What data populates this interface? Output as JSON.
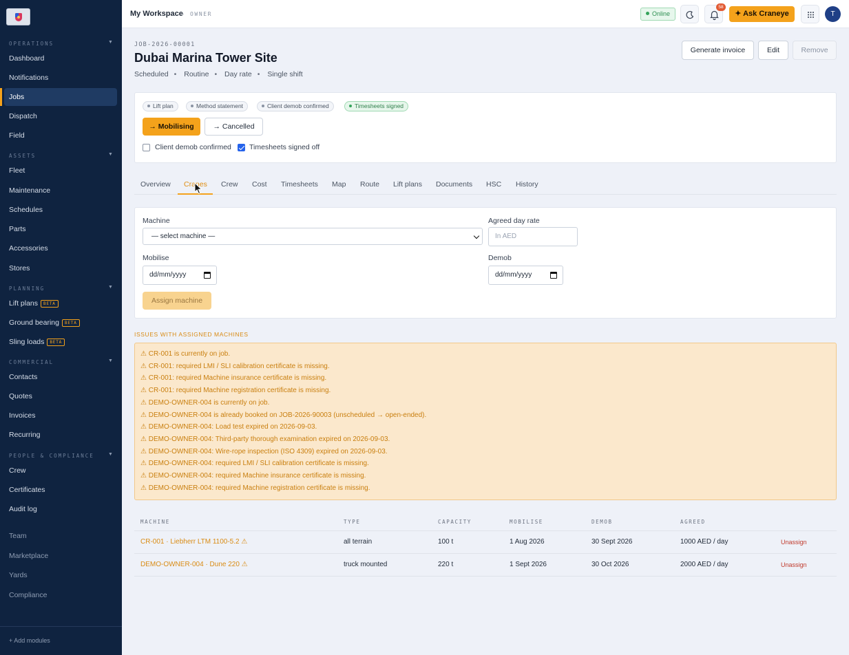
{
  "sidebar": {
    "sections": [
      {
        "title": "OPERATIONS",
        "items": [
          {
            "label": "Dashboard"
          },
          {
            "label": "Notifications"
          },
          {
            "label": "Jobs"
          },
          {
            "label": "Dispatch"
          },
          {
            "label": "Field"
          }
        ]
      },
      {
        "title": "ASSETS",
        "items": [
          {
            "label": "Fleet"
          },
          {
            "label": "Maintenance"
          },
          {
            "label": "Schedules"
          },
          {
            "label": "Parts"
          },
          {
            "label": "Accessories"
          },
          {
            "label": "Stores"
          }
        ]
      },
      {
        "title": "PLANNING",
        "items": [
          {
            "label": "Lift plans",
            "badge": "BETA"
          },
          {
            "label": "Ground bearing",
            "badge": "BETA"
          },
          {
            "label": "Sling loads",
            "badge": "BETA"
          }
        ]
      },
      {
        "title": "COMMERCIAL",
        "items": [
          {
            "label": "Contacts"
          },
          {
            "label": "Quotes"
          },
          {
            "label": "Invoices"
          },
          {
            "label": "Recurring"
          }
        ]
      },
      {
        "title": "PEOPLE & COMPLIANCE",
        "items": [
          {
            "label": "Crew"
          },
          {
            "label": "Certificates"
          },
          {
            "label": "Audit log"
          }
        ]
      }
    ],
    "extra_items": [
      "Team",
      "Marketplace",
      "Yards",
      "Compliance"
    ],
    "add_modules": "Add modules",
    "active_item": "Jobs"
  },
  "topbar": {
    "workspace": "My Workspace",
    "separator": "·",
    "role": "OWNER",
    "status": "Online",
    "notification_count": "58",
    "ask_label": "Ask Craneye",
    "avatar_initial": "T"
  },
  "job": {
    "code": "JOB-2026-00001",
    "title": "Dubai Marina Tower Site",
    "meta": [
      "Scheduled",
      "Routine",
      "Day rate",
      "Single shift"
    ],
    "actions": {
      "generate_invoice": "Generate invoice",
      "edit": "Edit",
      "remove": "Remove"
    }
  },
  "status_card": {
    "chips": [
      {
        "label": "Lift plan",
        "ok": false
      },
      {
        "label": "Method statement",
        "ok": false
      },
      {
        "label": "Client demob confirmed",
        "ok": false
      },
      {
        "label": "Timesheets signed",
        "ok": true
      }
    ],
    "transitions": {
      "primary": "→ Mobilising",
      "secondary": "→ Cancelled"
    },
    "checkboxes": [
      {
        "label": "Client demob confirmed",
        "checked": false
      },
      {
        "label": "Timesheets signed off",
        "checked": true
      }
    ]
  },
  "tabs": [
    "Overview",
    "Cranes",
    "Crew",
    "Cost",
    "Timesheets",
    "Map",
    "Route",
    "Lift plans",
    "Documents",
    "HSC",
    "History"
  ],
  "active_tab": "Cranes",
  "form": {
    "machine_label": "Machine",
    "machine_value": "— select machine —",
    "rate_label": "Agreed day rate",
    "rate_placeholder": "In AED",
    "mobilise_label": "Mobilise",
    "mobilise_value": "dd/mm/yyyy",
    "demob_label": "Demob",
    "demob_value": "dd/mm/yyyy",
    "assign_label": "Assign machine"
  },
  "issues": {
    "title": "ISSUES WITH ASSIGNED MACHINES",
    "items": [
      "⚠ CR-001 is currently on job.",
      "⚠ CR-001: required LMI / SLI calibration certificate is missing.",
      "⚠ CR-001: required Machine insurance certificate is missing.",
      "⚠ CR-001: required Machine registration certificate is missing.",
      "⚠ DEMO-OWNER-004 is currently on job.",
      "⚠ DEMO-OWNER-004 is already booked on JOB-2026-90003 (unscheduled → open-ended).",
      "⚠ DEMO-OWNER-004: Load test expired on 2026-09-03.",
      "⚠ DEMO-OWNER-004: Third-party thorough examination expired on 2026-09-03.",
      "⚠ DEMO-OWNER-004: Wire-rope inspection (ISO 4309) expired on 2026-09-03.",
      "⚠ DEMO-OWNER-004: required LMI / SLI calibration certificate is missing.",
      "⚠ DEMO-OWNER-004: required Machine insurance certificate is missing.",
      "⚠ DEMO-OWNER-004: required Machine registration certificate is missing."
    ]
  },
  "table": {
    "headers": [
      "MACHINE",
      "TYPE",
      "CAPACITY",
      "MOBILISE",
      "DEMOB",
      "AGREED"
    ],
    "rows": [
      {
        "machine": "CR-001 · Liebherr LTM 1100-5.2  ⚠",
        "type": "all terrain",
        "capacity": "100 t",
        "mobilise": "1 Aug 2026",
        "demob": "30 Sept 2026",
        "agreed": "1000 AED / day",
        "action": "Unassign"
      },
      {
        "machine": "DEMO-OWNER-004 · Dune 220  ⚠",
        "type": "truck mounted",
        "capacity": "220 t",
        "mobilise": "1 Sept 2026",
        "demob": "30 Oct 2026",
        "agreed": "2000 AED / day",
        "action": "Unassign"
      }
    ]
  }
}
